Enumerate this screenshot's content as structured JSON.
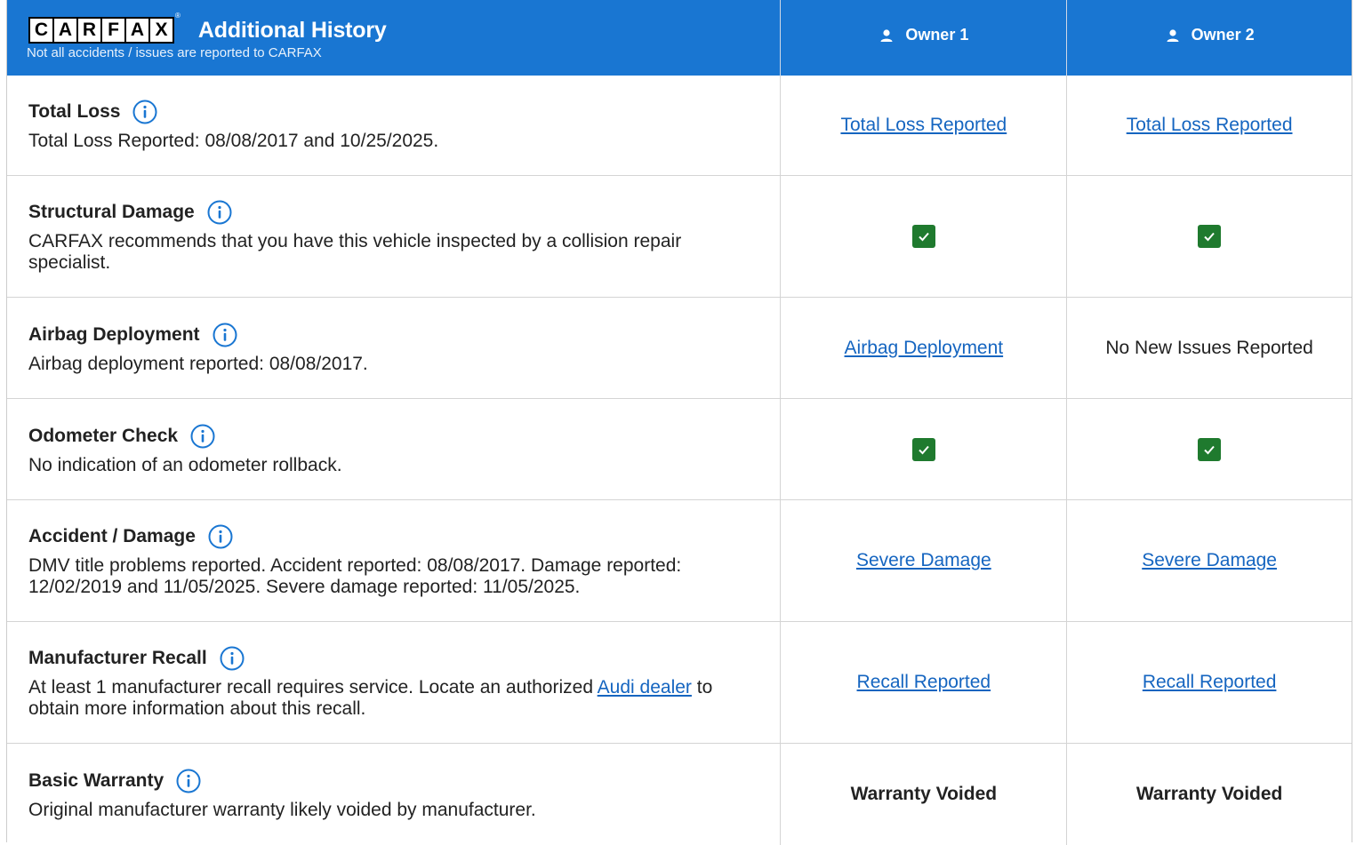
{
  "header": {
    "logo_letters": [
      "C",
      "A",
      "R",
      "F",
      "A",
      "X"
    ],
    "logo_reg": "®",
    "title": "Additional History",
    "subtitle": "Not all accidents / issues are reported to CARFAX",
    "owners": [
      "Owner 1",
      "Owner 2"
    ]
  },
  "rows": [
    {
      "title": "Total Loss",
      "description": "Total Loss Reported: 08/08/2017 and 10/25/2025.",
      "owner1": {
        "type": "link",
        "text": "Total Loss Reported"
      },
      "owner2": {
        "type": "link",
        "text": "Total Loss Reported"
      }
    },
    {
      "title": "Structural Damage",
      "description": "CARFAX recommends that you have this vehicle inspected by a collision repair specialist.",
      "owner1": {
        "type": "check"
      },
      "owner2": {
        "type": "check"
      }
    },
    {
      "title": "Airbag Deployment",
      "description": "Airbag deployment reported: 08/08/2017.",
      "owner1": {
        "type": "link",
        "text": "Airbag Deployment"
      },
      "owner2": {
        "type": "text",
        "text": "No New Issues Reported"
      }
    },
    {
      "title": "Odometer Check",
      "description": "No indication of an odometer rollback.",
      "owner1": {
        "type": "check"
      },
      "owner2": {
        "type": "check"
      }
    },
    {
      "title": "Accident / Damage",
      "description": "DMV title problems reported. Accident reported: 08/08/2017. Damage reported: 12/02/2019 and 11/05/2025. Severe damage reported: 11/05/2025.",
      "owner1": {
        "type": "link",
        "text": "Severe Damage"
      },
      "owner2": {
        "type": "link",
        "text": "Severe Damage"
      }
    },
    {
      "title": "Manufacturer Recall",
      "description_pre": "At least 1 manufacturer recall requires service. Locate an authorized ",
      "description_link": "Audi dealer",
      "description_post": " to obtain more information about this recall.",
      "owner1": {
        "type": "link",
        "text": "Recall Reported"
      },
      "owner2": {
        "type": "link",
        "text": "Recall Reported"
      }
    },
    {
      "title": "Basic Warranty",
      "description": "Original manufacturer warranty likely voided by manufacturer.",
      "owner1": {
        "type": "bold",
        "text": "Warranty Voided"
      },
      "owner2": {
        "type": "bold",
        "text": "Warranty Voided"
      }
    }
  ],
  "icons": {
    "info": "info-circle-icon",
    "person": "person-icon",
    "check": "checkmark-icon"
  },
  "colors": {
    "header_bg": "#1976d2",
    "link": "#1565c0",
    "check_bg": "#1f7a2e"
  }
}
